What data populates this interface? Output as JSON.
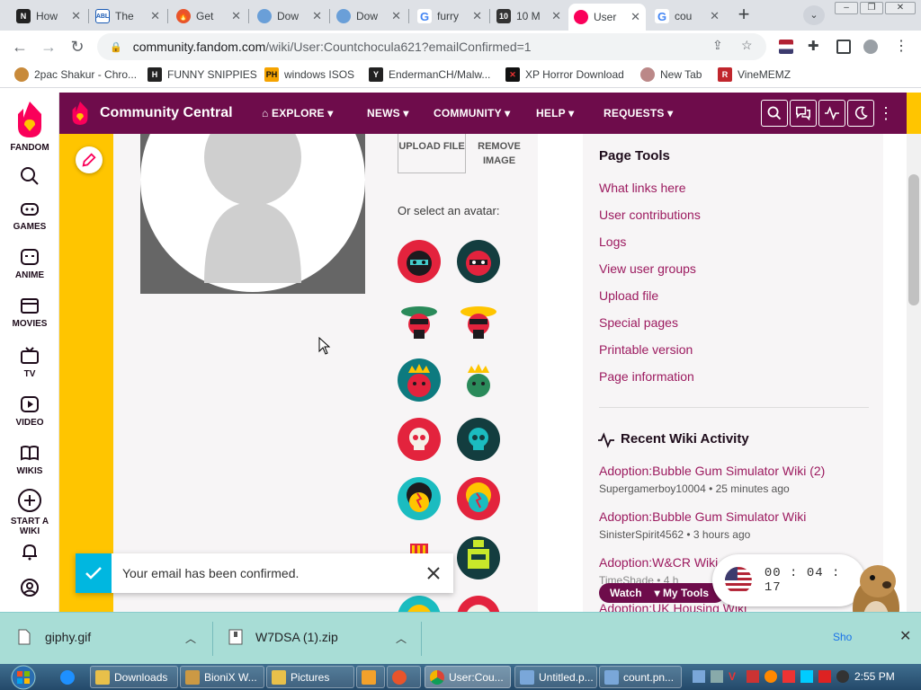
{
  "browser": {
    "tabs": [
      {
        "title": "How",
        "icon": "notion-icon"
      },
      {
        "title": "The",
        "icon": "abl-icon"
      },
      {
        "title": "Get",
        "icon": "fire-icon"
      },
      {
        "title": "Dow",
        "icon": "globe-icon"
      },
      {
        "title": "Dow",
        "icon": "globe-icon"
      },
      {
        "title": "furry",
        "icon": "google-icon"
      },
      {
        "title": "10 M",
        "icon": "ten-icon"
      },
      {
        "title": "User",
        "icon": "fandom-icon",
        "active": true
      },
      {
        "title": "cou",
        "icon": "google-icon"
      }
    ],
    "url_host": "community.fandom.com",
    "url_path": "/wiki/User:Countchocula621?emailConfirmed=1",
    "bookmarks": [
      {
        "label": "2pac Shakur - Chro..."
      },
      {
        "label": "FUNNY SNIPPIES"
      },
      {
        "label": "windows ISOS"
      },
      {
        "label": "EndermanCH/Malw..."
      },
      {
        "label": "XP Horror Download"
      },
      {
        "label": "New Tab"
      },
      {
        "label": "VineMEMZ"
      }
    ]
  },
  "fandom_rail": {
    "logo_label": "FANDOM",
    "items": [
      {
        "label": "GAMES"
      },
      {
        "label": "ANIME"
      },
      {
        "label": "MOVIES"
      },
      {
        "label": "TV"
      },
      {
        "label": "VIDEO"
      },
      {
        "label": "WIKIS"
      },
      {
        "label": "START A WIKI"
      }
    ]
  },
  "wiki_header": {
    "name": "Community Central",
    "nav": [
      {
        "label": "EXPLORE"
      },
      {
        "label": "NEWS"
      },
      {
        "label": "COMMUNITY"
      },
      {
        "label": "HELP"
      },
      {
        "label": "REQUESTS"
      }
    ]
  },
  "avatar_editor": {
    "upload_label": "UPLOAD FILE",
    "remove_label": "REMOVE IMAGE",
    "select_label": "Or select an avatar:"
  },
  "page_tools": {
    "title": "Page Tools",
    "links": [
      "What links here",
      "User contributions",
      "Logs",
      "View user groups",
      "Upload file",
      "Special pages",
      "Printable version",
      "Page information"
    ]
  },
  "recent_activity": {
    "title": "Recent Wiki Activity",
    "items": [
      {
        "title": "Adoption:Bubble Gum Simulator Wiki (2)",
        "meta": "Supergamerboy10004 • 25 minutes ago"
      },
      {
        "title": "Adoption:Bubble Gum Simulator Wiki",
        "meta": "SinisterSpirit4562 • 3 hours ago"
      },
      {
        "title": "Adoption:W&CR Wiki",
        "meta": "TimeShade • 4 h"
      },
      {
        "title": "Adoption:UK Housing Wiki",
        "meta": ""
      }
    ]
  },
  "toast": {
    "text": "Your email has been confirmed."
  },
  "watch_bar": {
    "watch": "Watch",
    "tools": "My Tools"
  },
  "timer": {
    "value": "00 : 04 : 17"
  },
  "downloads": [
    {
      "name": "giphy.gif"
    },
    {
      "name": "W7DSA (1).zip"
    }
  ],
  "downloads_show_all": "Sho",
  "taskbar": {
    "items": [
      {
        "label": "Downloads"
      },
      {
        "label": "BioniX W..."
      },
      {
        "label": "Pictures"
      },
      {
        "label": ""
      },
      {
        "label": ""
      },
      {
        "label": "User:Cou..."
      },
      {
        "label": "Untitled.p..."
      },
      {
        "label": "count.pn..."
      }
    ],
    "clock": "2:55 PM"
  }
}
